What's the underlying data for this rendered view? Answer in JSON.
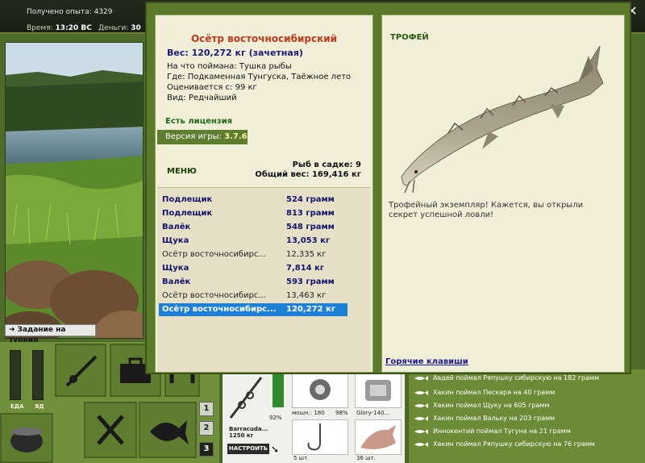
{
  "topbar": {
    "xp_label": "Получено опыта: 4329",
    "time_label": "Время:",
    "time_value": "13:20 ВС",
    "money_label": "Деньги:",
    "money_value": "30"
  },
  "left": {
    "tournament_btn": "Задание на турнир",
    "meter_food": "ЕДА",
    "meter_poison": "ЯД",
    "page_buttons": [
      "1",
      "2",
      "3"
    ]
  },
  "gear": {
    "rod_name": "Barracuda...",
    "rod_weight": "1250 кг",
    "percent": "92%",
    "reel_line": "мошн.: 180",
    "reel_percent": "98%",
    "line_name": "Glory-140...",
    "setup_btn": "НАСТРОИТЬ",
    "hooks_count": "5 шт.",
    "bait_count": "36 шт."
  },
  "feed": {
    "items": [
      "Авдей поймал Ряпушку сибирскую на 182 грамм",
      "Хакин поймал Пескаря на 40 грамм",
      "Хакин поймал Щуку на 605 грамм",
      "Хакин поймал Вальку на 203 грамм",
      "Иннокентий поймал Тугуна на 21 грамм",
      "Хакин поймал Ряпушку сибирскую на 76 грамм"
    ]
  },
  "dialog": {
    "fish_title": "Осётр восточносибирский",
    "weight": "Вес: 120,272 кг (зачетная)",
    "caught_on": "На что поймана: Тушка рыбы",
    "where": "Где: Подкаменная Тунгуска, Таёжное лето",
    "valued": "Оценивается с: 99 кг",
    "species": "Вид: Редчайший",
    "license": "Есть лицензия",
    "version_label": "Версия игры:",
    "version_value": "3.7.6",
    "menu": "МЕНЮ",
    "in_keepnet": "Рыб в садке: 9",
    "total_weight": "Общий вес: 169,416 кг",
    "catches": [
      {
        "name": "Подлещик",
        "weight": "524 грамм",
        "style": "bold"
      },
      {
        "name": "Подлещик",
        "weight": "813 грамм",
        "style": "bold"
      },
      {
        "name": "Валёк",
        "weight": "548 грамм",
        "style": "bold"
      },
      {
        "name": "Щука",
        "weight": "13,053 кг",
        "style": "bold"
      },
      {
        "name": "Осётр восточносибирс...",
        "weight": "12,335 кг",
        "style": "plain"
      },
      {
        "name": "Щука",
        "weight": "7,814 кг",
        "style": "bold"
      },
      {
        "name": "Валёк",
        "weight": "593 грамм",
        "style": "bold"
      },
      {
        "name": "Осётр восточносибирс...",
        "weight": "13,463 кг",
        "style": "plain"
      },
      {
        "name": "Осётр восточносибирс...",
        "weight": "120,272 кг",
        "style": "selected"
      }
    ],
    "trophy_label": "ТРОФЕЙ",
    "trophy_text": "Трофейный экземпляр! Кажется, вы открыли секрет успешной ловли!",
    "hotkeys": "Горячие клавиши"
  },
  "colors": {
    "accent_green": "#5e7d2f",
    "title_red": "#c0391a",
    "selection_blue": "#1e7fd6"
  }
}
